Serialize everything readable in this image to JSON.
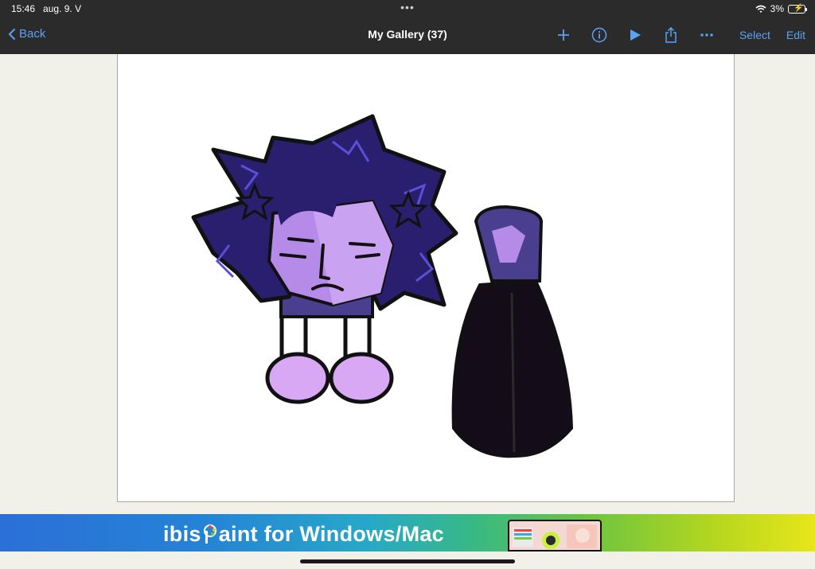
{
  "status_bar": {
    "time": "15:46",
    "date": "aug. 9. V",
    "battery": "3%"
  },
  "nav": {
    "back_label": "Back",
    "title": "My Gallery (37)",
    "select_label": "Select",
    "edit_label": "Edit",
    "icons": [
      "plus-icon",
      "info-icon",
      "play-icon",
      "share-icon",
      "more-icon"
    ]
  },
  "banner": {
    "text_before": "ibis",
    "text_after": "aint",
    "text_tail": "for Windows/Mac"
  },
  "colors": {
    "accent": "#5ba2f5",
    "toolbar": "#2b2b2b",
    "background": "#f2f1e9"
  }
}
